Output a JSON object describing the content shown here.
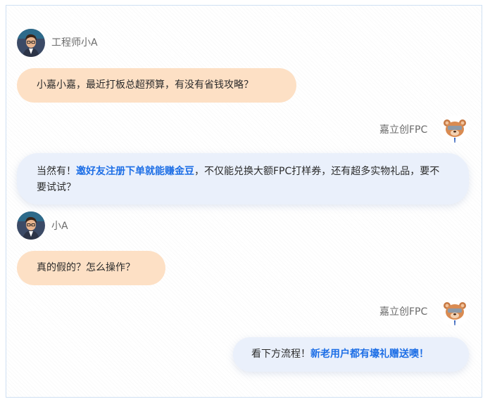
{
  "colors": {
    "user_bubble": "#fde0c5",
    "bot_bubble": "#eaf0fb",
    "highlight": "#1e6fe6",
    "frame_border": "#cfe0f3"
  },
  "messages": [
    {
      "role": "user",
      "sender": "工程师小A",
      "avatar_icon": "engineer-avatar-icon",
      "parts": [
        {
          "text": "小嘉小嘉，最近打板总超预算，有没有省钱攻略？",
          "highlight": false
        }
      ]
    },
    {
      "role": "bot",
      "sender": "嘉立创FPC",
      "avatar_icon": "bear-mascot-icon",
      "parts": [
        {
          "text": "当然有！",
          "highlight": false
        },
        {
          "text": "邀好友注册下单就能赚金豆",
          "highlight": true
        },
        {
          "text": "，不仅能兑换大额FPC打样券，还有超多实物礼品，要不要试试？",
          "highlight": false
        }
      ]
    },
    {
      "role": "user",
      "sender": "小A",
      "avatar_icon": "engineer-avatar-icon",
      "parts": [
        {
          "text": "真的假的？怎么操作？",
          "highlight": false
        }
      ]
    },
    {
      "role": "bot",
      "sender": "嘉立创FPC",
      "avatar_icon": "bear-mascot-icon",
      "parts": [
        {
          "text": "看下方流程！",
          "highlight": false
        },
        {
          "text": "新老用户都有壕礼赠送噢！",
          "highlight": true
        }
      ]
    }
  ]
}
